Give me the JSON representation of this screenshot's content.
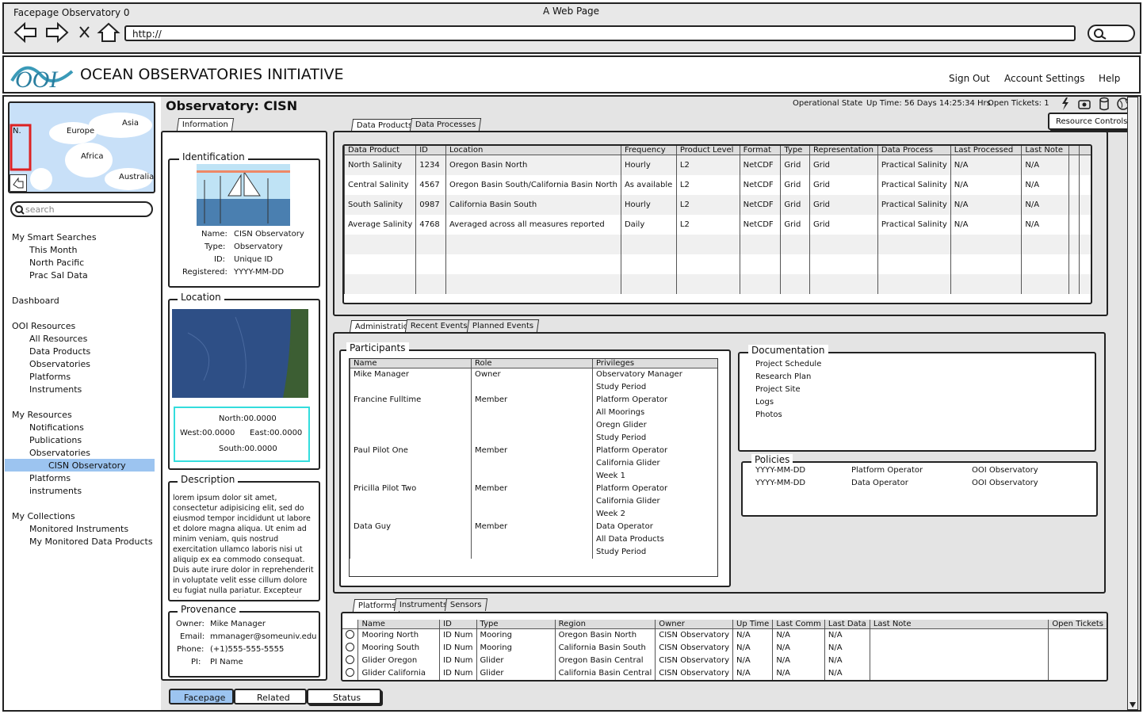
{
  "browser": {
    "tab_title": "Facepage Observatory 0",
    "window_title": "A Web Page",
    "url": "http://"
  },
  "header": {
    "brand": "OCEAN OBSERVATORIES INITIATIVE",
    "links": [
      "Sign Out",
      "Account Settings",
      "Help"
    ]
  },
  "map": {
    "labels": [
      "Asia",
      "Europe",
      "Africa",
      "Australia",
      "N."
    ]
  },
  "search": {
    "placeholder": "search"
  },
  "nav": {
    "smart_searches": "My Smart Searches",
    "ss_items": [
      "This Month",
      "North Pacific",
      "Prac Sal Data"
    ],
    "dashboard": "Dashboard",
    "ooi_resources": "OOI Resources",
    "ooi_items": [
      "All Resources",
      "Data Products",
      "Observatories",
      "Platforms",
      "Instruments"
    ],
    "my_resources": "My Resources",
    "my_items": [
      "Notifications",
      "Publications",
      "Observatories"
    ],
    "selected": "CISN Observatory",
    "my_items2": [
      "Platforms",
      "instruments"
    ],
    "collections": "My Collections",
    "col_items": [
      "Monitored Instruments",
      "My Monitored Data Products"
    ]
  },
  "page": {
    "title": "Observatory: CISN",
    "status": "Operational State",
    "uptime": "Up Time: 56 Days 14:25:34 Hrs",
    "tickets": "Open Tickets: 1",
    "resource_controls": "Resource Controls"
  },
  "info": {
    "tab": "Information",
    "identification": "Identification",
    "fields": [
      [
        "Name:",
        "CISN Observatory"
      ],
      [
        "Type:",
        "Observatory"
      ],
      [
        "ID:",
        "Unique ID"
      ],
      [
        "Registered:",
        "YYYY-MM-DD"
      ]
    ],
    "location": "Location",
    "north": "North:00.0000",
    "west": "West:00.0000",
    "east": "East:00.0000",
    "south": "South:00.0000",
    "description": "Description",
    "description_text": "lorem ipsum dolor sit amet, consectetur adipisicing elit, sed do eiusmod tempor incididunt ut labore et dolore magna aliqua. Ut enim ad minim veniam, quis nostrud exercitation ullamco laboris nisi ut aliquip ex ea commodo consequat. Duis aute irure dolor in reprehenderit in voluptate velit esse cillum dolore eu fugiat nulla pariatur. Excepteur sint occaecat cupidatat non proident, sunt in",
    "provenance": "Provenance",
    "prov": [
      [
        "Owner:",
        "Mike Manager"
      ],
      [
        "Email:",
        "mmanager@someuniv.edu"
      ],
      [
        "Phone:",
        "(+1)555-555-5555"
      ],
      [
        "PI:",
        "PI Name"
      ]
    ]
  },
  "dp": {
    "tabs": [
      "Data Products",
      "Data Processes"
    ],
    "headers": [
      "Data Product",
      "ID",
      "Location",
      "Frequency",
      "Product Level",
      "Format",
      "Type",
      "Representation",
      "Data Process",
      "Last Processed",
      "Last Note"
    ],
    "rows": [
      [
        "North Salinity",
        "1234",
        "Oregon Basin North",
        "Hourly",
        "L2",
        "NetCDF",
        "Grid",
        "Grid",
        "Practical Salinity",
        "N/A",
        "N/A"
      ],
      [
        "Central Salinity",
        "4567",
        "Oregon Basin South/California Basin North",
        "As available",
        "L2",
        "NetCDF",
        "Grid",
        "Grid",
        "Practical Salinity",
        "N/A",
        "N/A"
      ],
      [
        "South Salinity",
        "0987",
        "California Basin South",
        "Hourly",
        "L2",
        "NetCDF",
        "Grid",
        "Grid",
        "Practical Salinity",
        "N/A",
        "N/A"
      ],
      [
        "Average Salinity",
        "4768",
        "Averaged across all measures reported",
        "Daily",
        "L2",
        "NetCDF",
        "Grid",
        "Grid",
        "Practical Salinity",
        "N/A",
        "N/A"
      ]
    ]
  },
  "admin": {
    "tabs": [
      "Administration",
      "Recent Events",
      "Planned Events"
    ],
    "participants": "Participants",
    "p_headers": [
      "Name",
      "Role",
      "Privileges"
    ],
    "p_rows": [
      [
        "Mike Manager",
        "Owner",
        "Observatory Manager"
      ],
      [
        "",
        "",
        "Study Period"
      ],
      [
        "Francine Fulltime",
        "Member",
        "Platform Operator"
      ],
      [
        "",
        "",
        "All Moorings"
      ],
      [
        "",
        "",
        "Oregn Glider"
      ],
      [
        "",
        "",
        "Study Period"
      ],
      [
        "Paul Pilot One",
        "Member",
        "Platform Operator"
      ],
      [
        "",
        "",
        "California Glider"
      ],
      [
        "",
        "",
        "Week 1"
      ],
      [
        "Pricilla Pilot Two",
        "Member",
        "Platform Operator"
      ],
      [
        "",
        "",
        "California Glider"
      ],
      [
        "",
        "",
        "Week 2"
      ],
      [
        "Data Guy",
        "Member",
        "Data Operator"
      ],
      [
        "",
        "",
        "All Data Products"
      ],
      [
        "",
        "",
        "Study Period"
      ]
    ],
    "documentation": "Documentation",
    "docs": [
      "Project Schedule",
      "Research Plan",
      "Project Site",
      "Logs",
      "Photos"
    ],
    "policies": "Policies",
    "pol": [
      [
        "YYYY-MM-DD",
        "Platform Operator",
        "OOI Observatory"
      ],
      [
        "YYYY-MM-DD",
        "Data Operator",
        "OOI Observatory"
      ]
    ]
  },
  "plat": {
    "tabs": [
      "Platforms",
      "Instruments",
      "Sensors"
    ],
    "headers": [
      "Name",
      "ID",
      "Type",
      "Region",
      "Owner",
      "Up Time",
      "Last Comm",
      "Last Data",
      "Last Note",
      "Open Tickets"
    ],
    "rows": [
      [
        "Mooring North",
        "ID Num",
        "Mooring",
        "Oregon Basin North",
        "CISN Observatory",
        "N/A",
        "N/A",
        "N/A",
        "",
        ""
      ],
      [
        "Mooring South",
        "ID Num",
        "Mooring",
        "California Basin South",
        "CISN Observatory",
        "N/A",
        "N/A",
        "N/A",
        "",
        ""
      ],
      [
        "Glider Oregon",
        "ID Num",
        "Glider",
        "Oregon Basin Central",
        "CISN Observatory",
        "N/A",
        "N/A",
        "N/A",
        "",
        ""
      ],
      [
        "Glider California",
        "ID Num",
        "Glider",
        "California Basin Central",
        "CISN Observatory",
        "N/A",
        "N/A",
        "N/A",
        "",
        ""
      ]
    ]
  },
  "bottom_tabs": [
    "Facepage",
    "Related",
    "Status"
  ]
}
